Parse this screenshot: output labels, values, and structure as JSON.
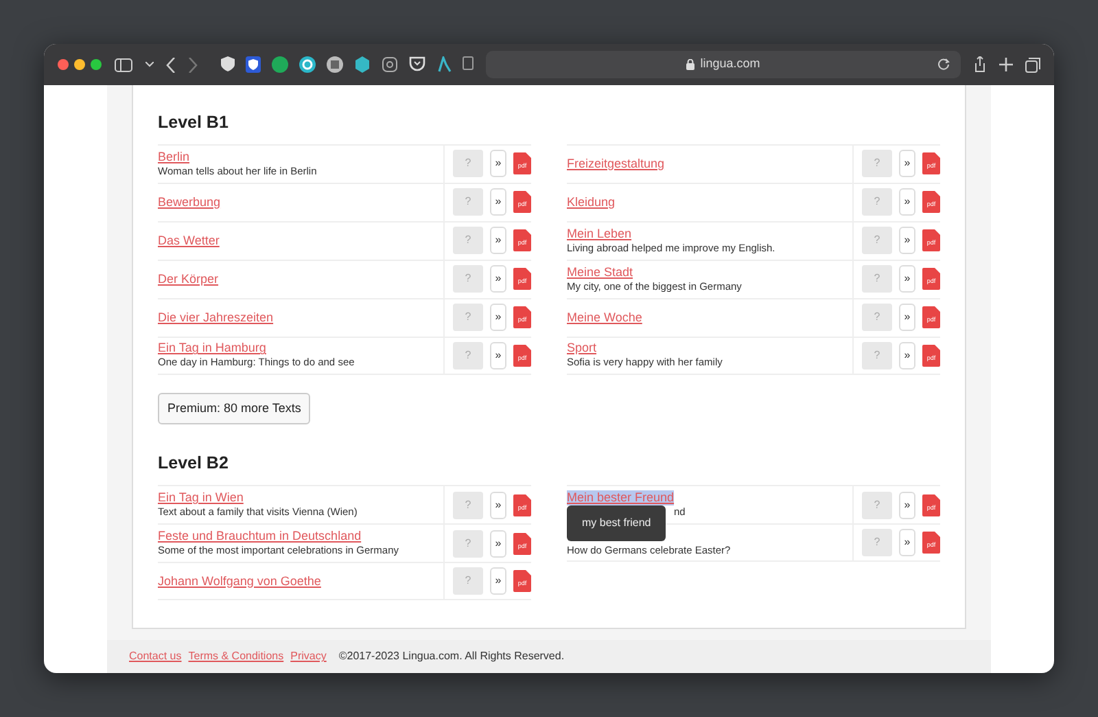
{
  "browser": {
    "url": "lingua.com"
  },
  "levels": [
    {
      "title": "Level B1",
      "columns": [
        [
          {
            "title": "Berlin",
            "description": "Woman tells about her life in Berlin",
            "buttons": [
              "?",
              "»",
              "pdf"
            ]
          },
          {
            "title": "Bewerbung",
            "buttons": [
              "?",
              "»",
              "pdf"
            ]
          },
          {
            "title": "Das Wetter",
            "buttons": [
              "?",
              "»",
              "pdf"
            ]
          },
          {
            "title": "Der Körper",
            "buttons": [
              "?",
              "»",
              "pdf"
            ]
          },
          {
            "title": "Die vier Jahreszeiten",
            "buttons": [
              "?",
              "»",
              "pdf"
            ]
          },
          {
            "title": "Ein Tag in Hamburg",
            "description": "One day in Hamburg: Things to do and see",
            "buttons": [
              "?",
              "»",
              "pdf"
            ]
          }
        ],
        [
          {
            "title": "Freizeitgestaltung",
            "buttons": [
              "?",
              "»",
              "pdf"
            ]
          },
          {
            "title": "Kleidung",
            "buttons": [
              "?",
              "»",
              "pdf"
            ]
          },
          {
            "title": "Mein Leben",
            "description": "Living abroad helped me improve my English.",
            "buttons": [
              "?",
              "»",
              "pdf"
            ]
          },
          {
            "title": "Meine Stadt",
            "description": "My city, one of the biggest in Germany",
            "buttons": [
              "?",
              "»",
              "pdf"
            ]
          },
          {
            "title": "Meine Woche",
            "buttons": [
              "?",
              "»",
              "pdf"
            ]
          },
          {
            "title": "Sport",
            "description": "Sofia is very happy with her family",
            "buttons": [
              "?",
              "»",
              "pdf"
            ]
          }
        ]
      ],
      "premium_button": "Premium: 80 more Texts"
    },
    {
      "title": "Level B2",
      "columns": [
        [
          {
            "title": "Ein Tag in Wien",
            "description": "Text about a family that visits Vienna (Wien)",
            "buttons": [
              "?",
              "»",
              "pdf"
            ]
          },
          {
            "title": "Feste und Brauchtum in Deutschland",
            "description": "Some of the most important celebrations in Germany",
            "buttons": [
              "?",
              "»",
              "pdf"
            ]
          },
          {
            "title": "Johann Wolfgang von Goethe",
            "buttons": [
              "?",
              "»",
              "pdf"
            ]
          }
        ],
        [
          {
            "title": "Mein bester Freund",
            "description": "nd",
            "highlighted": true,
            "tooltip": "my best friend",
            "buttons": [
              "?",
              "»",
              "pdf"
            ]
          },
          {
            "description": "How do Germans celebrate Easter?",
            "buttons": [
              "?",
              "»",
              "pdf"
            ]
          }
        ]
      ]
    }
  ],
  "footer": {
    "links": [
      "Contact us",
      "Terms & Conditions",
      "Privacy"
    ],
    "copyright": "©2017-2023 Lingua.com. All Rights Reserved."
  }
}
